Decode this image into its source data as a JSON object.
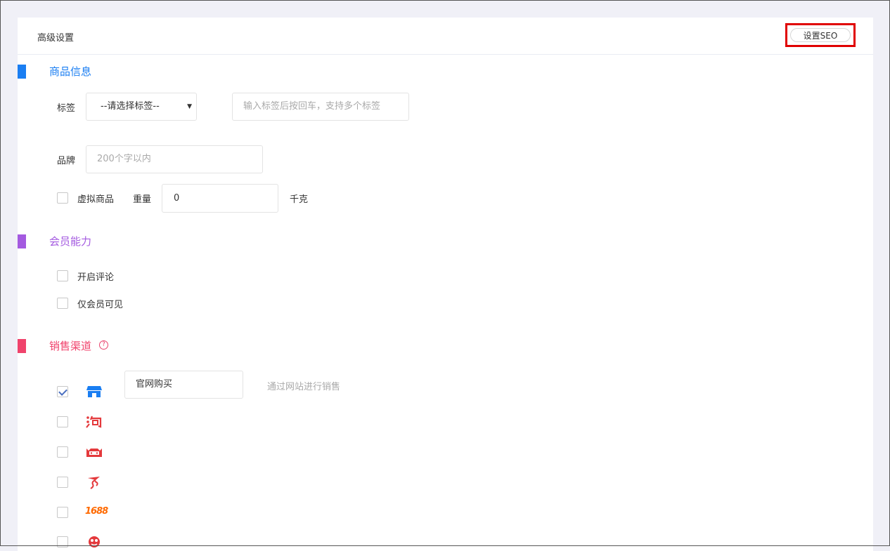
{
  "header": {
    "title": "高级设置",
    "seo_button": "设置SEO"
  },
  "sections": {
    "product": {
      "title": "商品信息",
      "color": "#1a7ef2"
    },
    "member": {
      "title": "会员能力",
      "color": "#a45ae0"
    },
    "sales": {
      "title": "销售渠道",
      "color": "#f0436c"
    }
  },
  "product": {
    "tag_label": "标签",
    "tag_select_value": "--请选择标签--",
    "tag_input_placeholder": "输入标签后按回车，支持多个标签",
    "brand_label": "品牌",
    "brand_placeholder": "200个字以内",
    "virtual_label": "虚拟商品",
    "weight_label": "重量",
    "weight_value": "0",
    "weight_unit": "千克"
  },
  "member": {
    "enable_comments": "开启评论",
    "members_only": "仅会员可见"
  },
  "sales": {
    "help_glyph": "?",
    "channels": [
      {
        "icon": "store-icon",
        "checked": true,
        "name": "官网购买",
        "description": "通过网站进行销售"
      },
      {
        "icon": "taobao-icon",
        "checked": false
      },
      {
        "icon": "tmall-icon",
        "checked": false
      },
      {
        "icon": "jd-icon",
        "checked": false
      },
      {
        "icon": "1688-icon",
        "checked": false,
        "icon_text": "1688"
      },
      {
        "icon": "pinduoduo-icon",
        "checked": false
      }
    ]
  }
}
